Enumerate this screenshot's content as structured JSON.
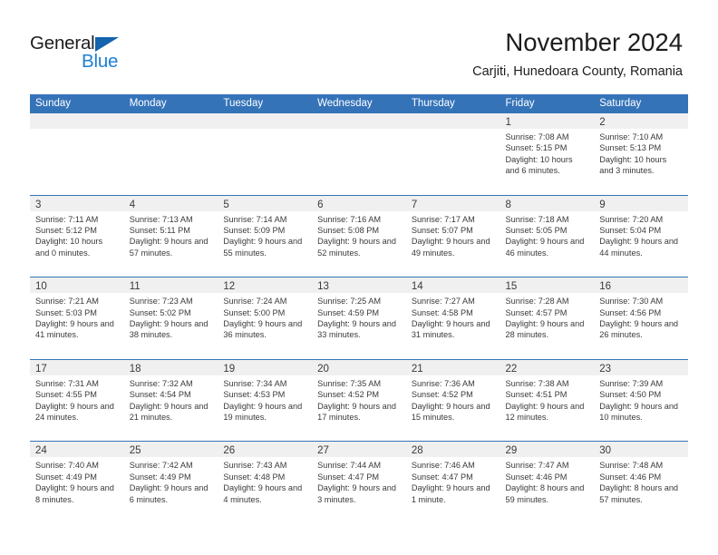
{
  "brand": {
    "word_one": "General",
    "word_two": "Blue",
    "triangle_color": "#1463ad",
    "blue_color": "#1b7fd4"
  },
  "header": {
    "title": "November 2024",
    "subtitle": "Carjiti, Hunedoara County, Romania"
  },
  "theme": {
    "header_blue": "#3573b9",
    "date_band": "#f0f0f0",
    "text": "#3a3a3a"
  },
  "calendar": {
    "weekday_headers": [
      "Sunday",
      "Monday",
      "Tuesday",
      "Wednesday",
      "Thursday",
      "Friday",
      "Saturday"
    ],
    "weeks": [
      [
        {
          "date": "",
          "empty": true
        },
        {
          "date": "",
          "empty": true
        },
        {
          "date": "",
          "empty": true
        },
        {
          "date": "",
          "empty": true
        },
        {
          "date": "",
          "empty": true
        },
        {
          "date": "1",
          "sunrise": "Sunrise: 7:08 AM",
          "sunset": "Sunset: 5:15 PM",
          "daylight": "Daylight: 10 hours and 6 minutes."
        },
        {
          "date": "2",
          "sunrise": "Sunrise: 7:10 AM",
          "sunset": "Sunset: 5:13 PM",
          "daylight": "Daylight: 10 hours and 3 minutes."
        }
      ],
      [
        {
          "date": "3",
          "sunrise": "Sunrise: 7:11 AM",
          "sunset": "Sunset: 5:12 PM",
          "daylight": "Daylight: 10 hours and 0 minutes."
        },
        {
          "date": "4",
          "sunrise": "Sunrise: 7:13 AM",
          "sunset": "Sunset: 5:11 PM",
          "daylight": "Daylight: 9 hours and 57 minutes."
        },
        {
          "date": "5",
          "sunrise": "Sunrise: 7:14 AM",
          "sunset": "Sunset: 5:09 PM",
          "daylight": "Daylight: 9 hours and 55 minutes."
        },
        {
          "date": "6",
          "sunrise": "Sunrise: 7:16 AM",
          "sunset": "Sunset: 5:08 PM",
          "daylight": "Daylight: 9 hours and 52 minutes."
        },
        {
          "date": "7",
          "sunrise": "Sunrise: 7:17 AM",
          "sunset": "Sunset: 5:07 PM",
          "daylight": "Daylight: 9 hours and 49 minutes."
        },
        {
          "date": "8",
          "sunrise": "Sunrise: 7:18 AM",
          "sunset": "Sunset: 5:05 PM",
          "daylight": "Daylight: 9 hours and 46 minutes."
        },
        {
          "date": "9",
          "sunrise": "Sunrise: 7:20 AM",
          "sunset": "Sunset: 5:04 PM",
          "daylight": "Daylight: 9 hours and 44 minutes."
        }
      ],
      [
        {
          "date": "10",
          "sunrise": "Sunrise: 7:21 AM",
          "sunset": "Sunset: 5:03 PM",
          "daylight": "Daylight: 9 hours and 41 minutes."
        },
        {
          "date": "11",
          "sunrise": "Sunrise: 7:23 AM",
          "sunset": "Sunset: 5:02 PM",
          "daylight": "Daylight: 9 hours and 38 minutes."
        },
        {
          "date": "12",
          "sunrise": "Sunrise: 7:24 AM",
          "sunset": "Sunset: 5:00 PM",
          "daylight": "Daylight: 9 hours and 36 minutes."
        },
        {
          "date": "13",
          "sunrise": "Sunrise: 7:25 AM",
          "sunset": "Sunset: 4:59 PM",
          "daylight": "Daylight: 9 hours and 33 minutes."
        },
        {
          "date": "14",
          "sunrise": "Sunrise: 7:27 AM",
          "sunset": "Sunset: 4:58 PM",
          "daylight": "Daylight: 9 hours and 31 minutes."
        },
        {
          "date": "15",
          "sunrise": "Sunrise: 7:28 AM",
          "sunset": "Sunset: 4:57 PM",
          "daylight": "Daylight: 9 hours and 28 minutes."
        },
        {
          "date": "16",
          "sunrise": "Sunrise: 7:30 AM",
          "sunset": "Sunset: 4:56 PM",
          "daylight": "Daylight: 9 hours and 26 minutes."
        }
      ],
      [
        {
          "date": "17",
          "sunrise": "Sunrise: 7:31 AM",
          "sunset": "Sunset: 4:55 PM",
          "daylight": "Daylight: 9 hours and 24 minutes."
        },
        {
          "date": "18",
          "sunrise": "Sunrise: 7:32 AM",
          "sunset": "Sunset: 4:54 PM",
          "daylight": "Daylight: 9 hours and 21 minutes."
        },
        {
          "date": "19",
          "sunrise": "Sunrise: 7:34 AM",
          "sunset": "Sunset: 4:53 PM",
          "daylight": "Daylight: 9 hours and 19 minutes."
        },
        {
          "date": "20",
          "sunrise": "Sunrise: 7:35 AM",
          "sunset": "Sunset: 4:52 PM",
          "daylight": "Daylight: 9 hours and 17 minutes."
        },
        {
          "date": "21",
          "sunrise": "Sunrise: 7:36 AM",
          "sunset": "Sunset: 4:52 PM",
          "daylight": "Daylight: 9 hours and 15 minutes."
        },
        {
          "date": "22",
          "sunrise": "Sunrise: 7:38 AM",
          "sunset": "Sunset: 4:51 PM",
          "daylight": "Daylight: 9 hours and 12 minutes."
        },
        {
          "date": "23",
          "sunrise": "Sunrise: 7:39 AM",
          "sunset": "Sunset: 4:50 PM",
          "daylight": "Daylight: 9 hours and 10 minutes."
        }
      ],
      [
        {
          "date": "24",
          "sunrise": "Sunrise: 7:40 AM",
          "sunset": "Sunset: 4:49 PM",
          "daylight": "Daylight: 9 hours and 8 minutes."
        },
        {
          "date": "25",
          "sunrise": "Sunrise: 7:42 AM",
          "sunset": "Sunset: 4:49 PM",
          "daylight": "Daylight: 9 hours and 6 minutes."
        },
        {
          "date": "26",
          "sunrise": "Sunrise: 7:43 AM",
          "sunset": "Sunset: 4:48 PM",
          "daylight": "Daylight: 9 hours and 4 minutes."
        },
        {
          "date": "27",
          "sunrise": "Sunrise: 7:44 AM",
          "sunset": "Sunset: 4:47 PM",
          "daylight": "Daylight: 9 hours and 3 minutes."
        },
        {
          "date": "28",
          "sunrise": "Sunrise: 7:46 AM",
          "sunset": "Sunset: 4:47 PM",
          "daylight": "Daylight: 9 hours and 1 minute."
        },
        {
          "date": "29",
          "sunrise": "Sunrise: 7:47 AM",
          "sunset": "Sunset: 4:46 PM",
          "daylight": "Daylight: 8 hours and 59 minutes."
        },
        {
          "date": "30",
          "sunrise": "Sunrise: 7:48 AM",
          "sunset": "Sunset: 4:46 PM",
          "daylight": "Daylight: 8 hours and 57 minutes."
        }
      ]
    ]
  }
}
